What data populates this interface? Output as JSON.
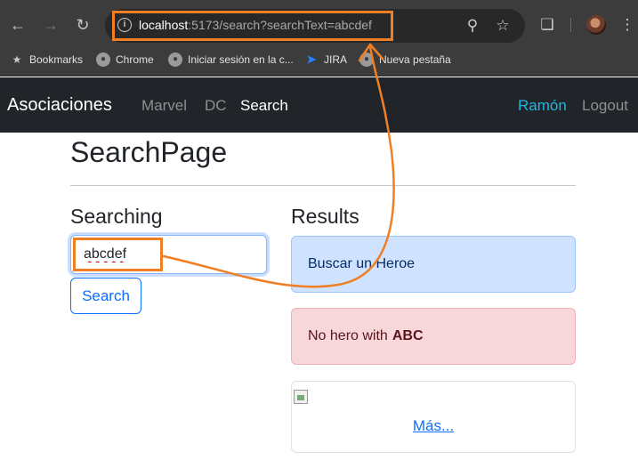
{
  "browser": {
    "url_host": "localhost",
    "url_rest": ":5173/search?searchText=abcdef",
    "bookmarks": [
      {
        "label": "Bookmarks",
        "icon": "star-icon"
      },
      {
        "label": "Chrome",
        "icon": "globe-icon"
      },
      {
        "label": "Iniciar sesión en la c...",
        "icon": "globe-icon"
      },
      {
        "label": "JIRA",
        "icon": "jira-icon"
      },
      {
        "label": "Nueva pestaña",
        "icon": "globe-icon"
      }
    ]
  },
  "navbar": {
    "brand": "Asociaciones",
    "links": [
      {
        "label": "Marvel",
        "active": false
      },
      {
        "label": "DC",
        "active": false
      },
      {
        "label": "Search",
        "active": true
      }
    ],
    "user": "Ramón",
    "logout": "Logout"
  },
  "page": {
    "title": "SearchPage",
    "searching_heading": "Searching",
    "results_heading": "Results"
  },
  "search": {
    "value": "abcdef",
    "button_label": "Search"
  },
  "results": {
    "info_alert": "Buscar un Heroe",
    "danger_prefix": "No hero with",
    "danger_query": "ABC",
    "more_link": "Más..."
  },
  "colors": {
    "annotation": "#f07f24",
    "navbar_bg": "#212529",
    "user_link": "#1fb6e6",
    "primary": "#0d6efd"
  }
}
